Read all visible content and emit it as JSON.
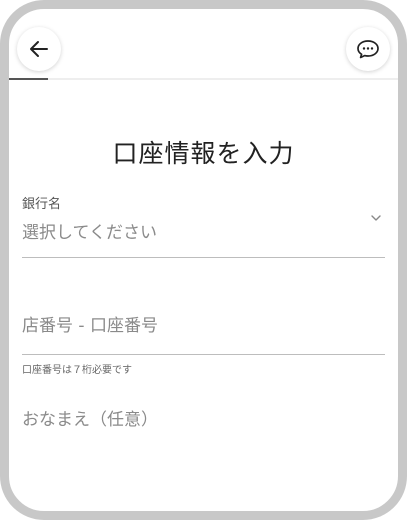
{
  "header": {
    "back_icon": "arrow-left-icon",
    "chat_icon": "chat-bubble-icon",
    "progress": 0.1
  },
  "title": "口座情報を入力",
  "bank_name": {
    "label": "銀行名",
    "placeholder": "選択してください",
    "icon": "chevron-down-icon"
  },
  "account_number": {
    "placeholder": "店番号 - 口座番号",
    "helper": "口座番号は７桁必要です"
  },
  "name": {
    "placeholder": "おなまえ（任意）"
  }
}
